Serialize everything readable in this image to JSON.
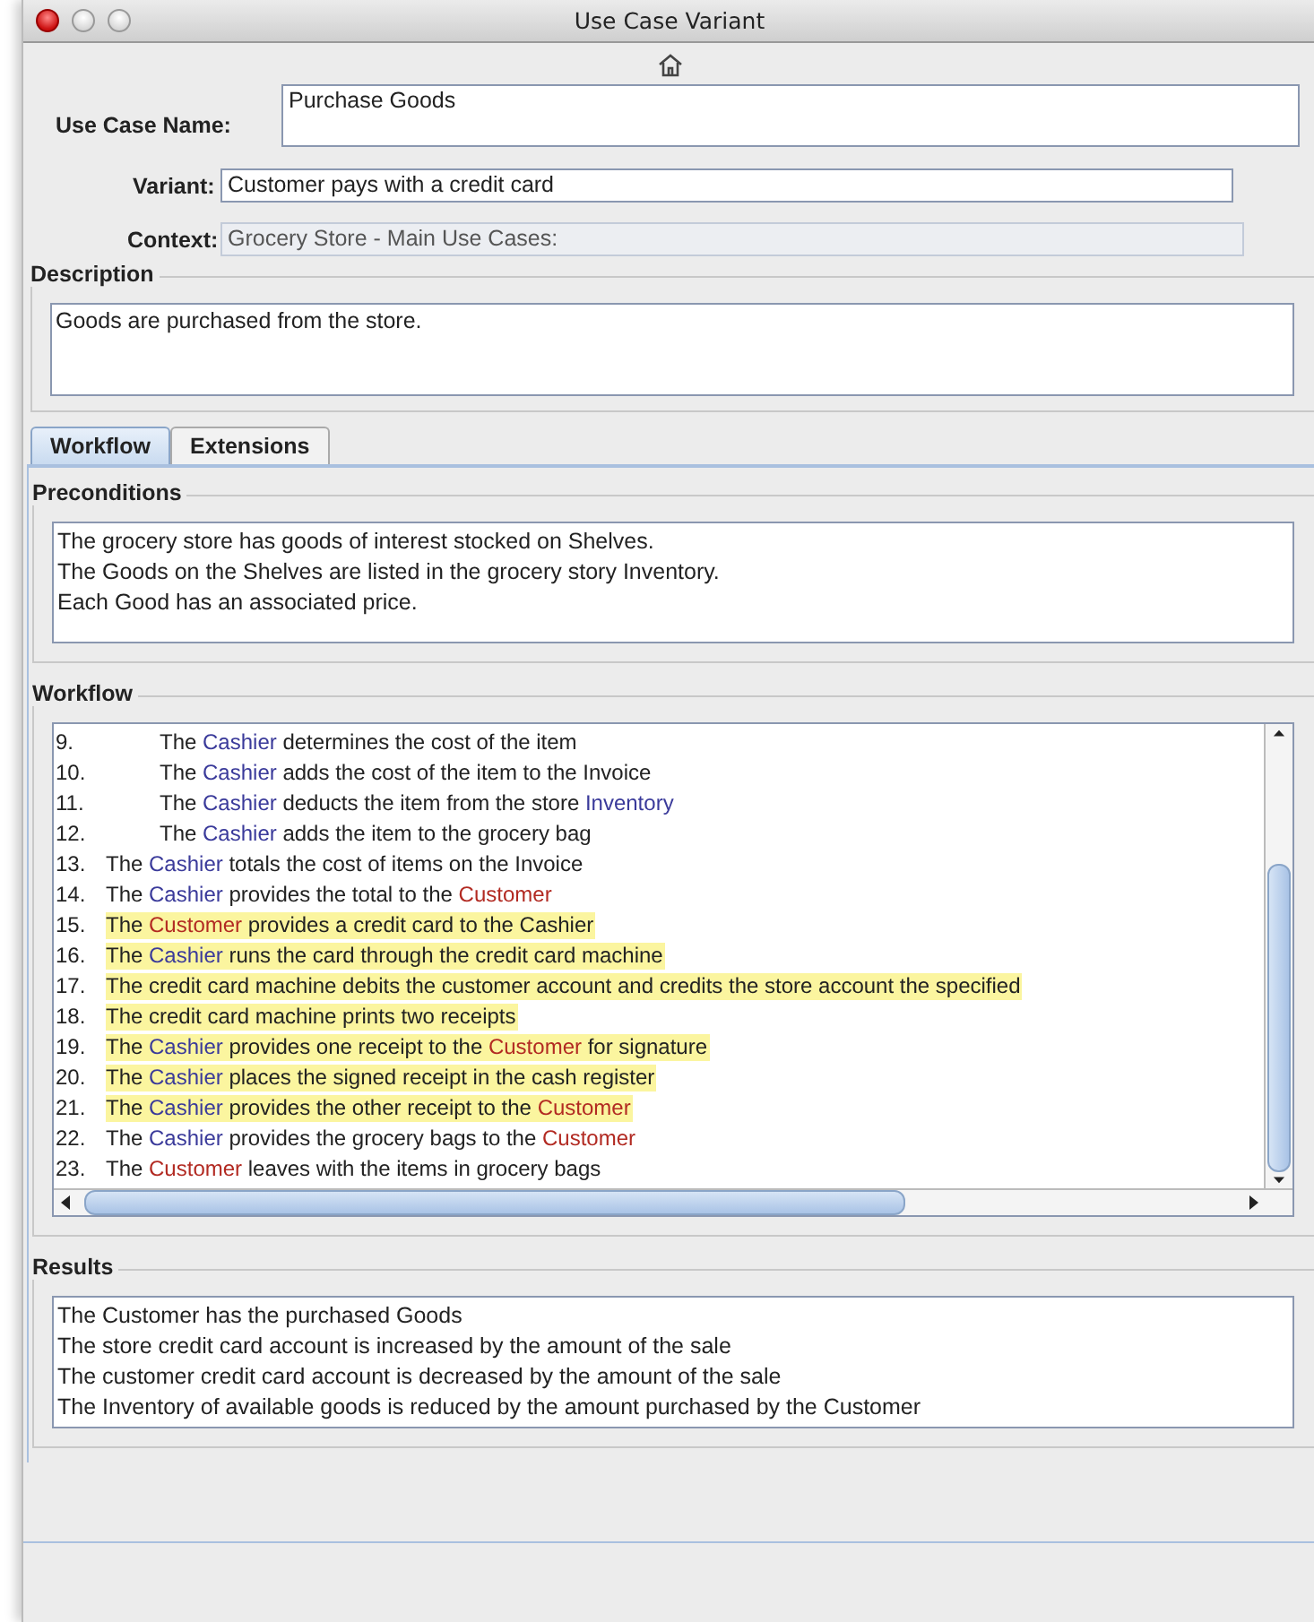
{
  "window": {
    "title": "Use Case Variant"
  },
  "use_case_name": {
    "label": "Use Case Name:",
    "value": "Purchase Goods"
  },
  "variant": {
    "label": "Variant:",
    "value": "Customer pays with a credit card"
  },
  "context": {
    "label": "Context:",
    "value": "Grocery Store - Main Use Cases:",
    "disabled": true
  },
  "description": {
    "title": "Description",
    "value": "Goods are purchased from the store."
  },
  "tabs": [
    {
      "label": "Workflow",
      "selected": true
    },
    {
      "label": "Extensions",
      "selected": false
    }
  ],
  "preconditions": {
    "title": "Preconditions",
    "lines": [
      "The grocery store has goods of interest stocked on Shelves.",
      "The Goods on the Shelves are listed in the grocery story Inventory.",
      "Each Good has an associated price."
    ]
  },
  "workflow": {
    "title": "Workflow",
    "steps": [
      {
        "number": "9.",
        "indent": true,
        "highlighted": false,
        "segments": [
          {
            "text": "The "
          },
          {
            "text": "Cashier",
            "color": "#3a3a9a"
          },
          {
            "text": " determines the cost of the item"
          }
        ]
      },
      {
        "number": "10.",
        "indent": true,
        "highlighted": false,
        "segments": [
          {
            "text": "The "
          },
          {
            "text": "Cashier",
            "color": "#3a3a9a"
          },
          {
            "text": " adds the cost of the item to the Invoice"
          }
        ]
      },
      {
        "number": "11.",
        "indent": true,
        "highlighted": false,
        "segments": [
          {
            "text": "The "
          },
          {
            "text": "Cashier",
            "color": "#3a3a9a"
          },
          {
            "text": " deducts the item from the store "
          },
          {
            "text": "Inventory",
            "color": "#3a3a9a"
          }
        ]
      },
      {
        "number": "12.",
        "indent": true,
        "highlighted": false,
        "segments": [
          {
            "text": "The "
          },
          {
            "text": "Cashier",
            "color": "#3a3a9a"
          },
          {
            "text": " adds the item to the grocery bag"
          }
        ]
      },
      {
        "number": "13.",
        "indent": false,
        "highlighted": false,
        "segments": [
          {
            "text": "The "
          },
          {
            "text": "Cashier",
            "color": "#3a3a9a"
          },
          {
            "text": " totals the cost of items on the Invoice"
          }
        ]
      },
      {
        "number": "14.",
        "indent": false,
        "highlighted": false,
        "segments": [
          {
            "text": "The "
          },
          {
            "text": "Cashier",
            "color": "#3a3a9a"
          },
          {
            "text": " provides the total to the "
          },
          {
            "text": "Customer",
            "color": "#b22a22"
          }
        ]
      },
      {
        "number": "15.",
        "indent": false,
        "highlighted": true,
        "segments": [
          {
            "text": "The "
          },
          {
            "text": "Customer",
            "color": "#b22a22"
          },
          {
            "text": " provides a credit card to the Cashier"
          }
        ]
      },
      {
        "number": "16.",
        "indent": false,
        "highlighted": true,
        "segments": [
          {
            "text": "The "
          },
          {
            "text": "Cashier",
            "color": "#3a3a9a"
          },
          {
            "text": " runs the card through the credit card machine"
          }
        ]
      },
      {
        "number": "17.",
        "indent": false,
        "highlighted": true,
        "segments": [
          {
            "text": "The credit card machine debits the customer account and credits the store account the specified"
          }
        ]
      },
      {
        "number": "18.",
        "indent": false,
        "highlighted": true,
        "segments": [
          {
            "text": "The credit card machine prints two receipts"
          }
        ]
      },
      {
        "number": "19.",
        "indent": false,
        "highlighted": true,
        "segments": [
          {
            "text": "The "
          },
          {
            "text": "Cashier",
            "color": "#3a3a9a"
          },
          {
            "text": " provides one receipt to the "
          },
          {
            "text": "Customer",
            "color": "#b22a22"
          },
          {
            "text": " for signature"
          }
        ]
      },
      {
        "number": "20.",
        "indent": false,
        "highlighted": true,
        "segments": [
          {
            "text": "The "
          },
          {
            "text": "Cashier",
            "color": "#3a3a9a"
          },
          {
            "text": " places the signed receipt in the cash register"
          }
        ]
      },
      {
        "number": "21.",
        "indent": false,
        "highlighted": true,
        "segments": [
          {
            "text": "The "
          },
          {
            "text": "Cashier",
            "color": "#3a3a9a"
          },
          {
            "text": " provides the other receipt to the "
          },
          {
            "text": "Customer",
            "color": "#b22a22"
          }
        ]
      },
      {
        "number": "22.",
        "indent": false,
        "highlighted": false,
        "segments": [
          {
            "text": "The "
          },
          {
            "text": "Cashier",
            "color": "#3a3a9a"
          },
          {
            "text": " provides the grocery bags to  the "
          },
          {
            "text": "Customer",
            "color": "#b22a22"
          }
        ]
      },
      {
        "number": "23.",
        "indent": false,
        "highlighted": false,
        "segments": [
          {
            "text": "The "
          },
          {
            "text": "Customer",
            "color": "#b22a22"
          },
          {
            "text": " leaves with the items in grocery bags"
          }
        ]
      }
    ]
  },
  "results": {
    "title": "Results",
    "lines": [
      "The Customer has the purchased Goods",
      "The store credit card account is increased by the amount of the sale",
      "The customer credit card account is decreased by the amount of the sale",
      "The Inventory of available goods is reduced by the amount purchased by the Customer"
    ]
  }
}
